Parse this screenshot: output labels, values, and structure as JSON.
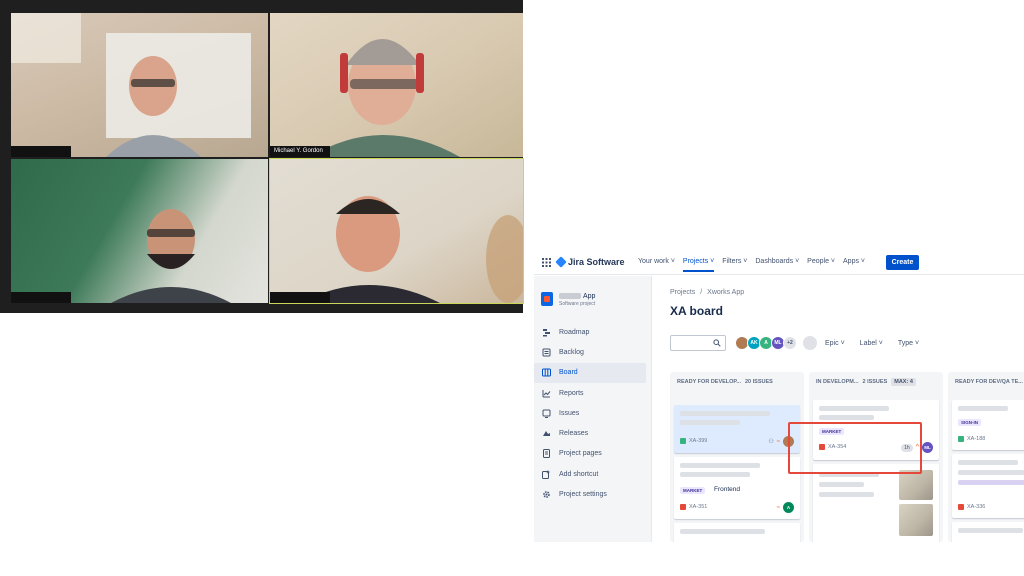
{
  "call": {
    "participants": [
      {
        "name": "",
        "active": false
      },
      {
        "name": "Michael Y. Gordon",
        "active": false
      },
      {
        "name": "",
        "active": false
      },
      {
        "name": "",
        "active": true
      }
    ]
  },
  "jira": {
    "app_name": "Jira Software",
    "nav": [
      {
        "label": "Your work",
        "active": false
      },
      {
        "label": "Projects",
        "active": true
      },
      {
        "label": "Filters",
        "active": false
      },
      {
        "label": "Dashboards",
        "active": false
      },
      {
        "label": "People",
        "active": false
      },
      {
        "label": "Apps",
        "active": false
      }
    ],
    "create_label": "Create",
    "project": {
      "name": "App",
      "type": "Software project"
    },
    "sidebar": [
      {
        "label": "Roadmap",
        "icon": "roadmap-icon",
        "selected": false
      },
      {
        "label": "Backlog",
        "icon": "backlog-icon",
        "selected": false
      },
      {
        "label": "Board",
        "icon": "board-icon",
        "selected": true
      },
      {
        "label": "Reports",
        "icon": "reports-icon",
        "selected": false
      },
      {
        "label": "Issues",
        "icon": "issues-icon",
        "selected": false
      },
      {
        "label": "Releases",
        "icon": "releases-icon",
        "selected": false
      },
      {
        "label": "Project pages",
        "icon": "project-pages-icon",
        "selected": false
      },
      {
        "label": "Add shortcut",
        "icon": "add-shortcut-icon",
        "selected": false
      },
      {
        "label": "Project settings",
        "icon": "gear-icon",
        "selected": false
      }
    ],
    "breadcrumb": [
      "Projects",
      "/",
      "Xworks App"
    ],
    "board_title": "XA board",
    "avatars": [
      {
        "initials": "",
        "color": "#b07a52"
      },
      {
        "initials": "AK",
        "color": "#00a3bf"
      },
      {
        "initials": "A",
        "color": "#36b37e"
      },
      {
        "initials": "ML",
        "color": "#6554c0"
      },
      {
        "initials": "+2",
        "color": "#dfe1e6"
      }
    ],
    "filters": [
      "Epic",
      "Label",
      "Type"
    ],
    "columns": [
      {
        "title": "READY FOR DEVELOP...",
        "count": "20 ISSUES",
        "max": ""
      },
      {
        "title": "IN DEVELOPM...",
        "count": "2 ISSUES",
        "max": "MAX: 4"
      },
      {
        "title": "READY FOR DEV/QA TE...",
        "count": "",
        "max": ""
      }
    ],
    "cards": {
      "c1a": {
        "key": "XA-399"
      },
      "c1b": {
        "label": "MARKET",
        "tag": "Frontend",
        "key": "XA-351",
        "avatar": "A"
      },
      "c2a": {
        "label": "MARKET",
        "key": "XA-354",
        "estimate": "1h",
        "avatar": "ML"
      },
      "c3a": {
        "label": "SIGN-IN",
        "key": "XA-188"
      },
      "c3b": {
        "key": "XA-336"
      }
    },
    "colors": {
      "primary": "#0052cc",
      "highlight": "#e5483a",
      "story": "#36b37e",
      "bug": "#e5493a"
    }
  }
}
